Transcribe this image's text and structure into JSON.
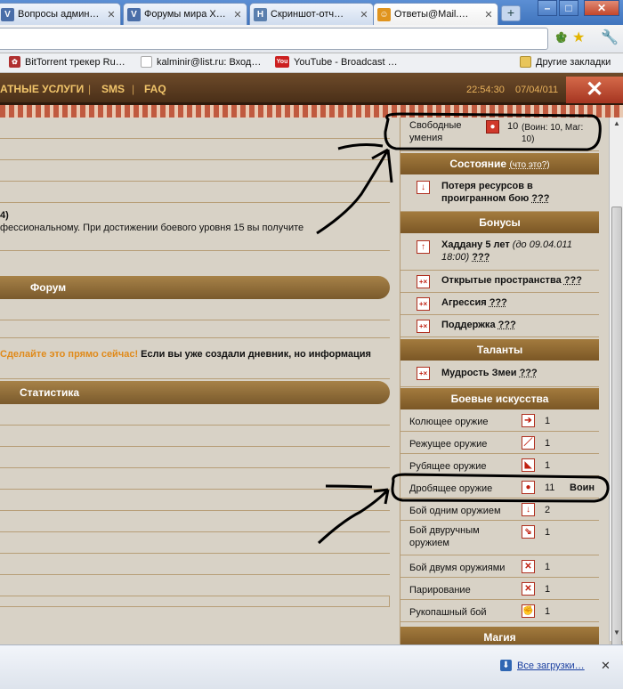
{
  "browser": {
    "tabs": [
      {
        "title": "Вопросы админ…",
        "favicon": "V",
        "color": "#4a6ea8"
      },
      {
        "title": "Форумы мира Х…",
        "favicon": "V",
        "color": "#4a6ea8"
      },
      {
        "title": "Скриншот-отч…",
        "favicon": "H",
        "color": "#5a7fae"
      },
      {
        "title": "Ответы@Mail.…",
        "favicon": "☺",
        "color": "#e0941e"
      }
    ],
    "new_tab": "+",
    "window_buttons": {
      "minimize": "–",
      "maximize": "□",
      "close": "✕"
    },
    "bookmarks": [
      {
        "label": "BitTorrent трекер Ru…",
        "color": "#b03030"
      },
      {
        "label": "kalminir@list.ru: Вход…",
        "color": "#3a5ea0"
      },
      {
        "label": "YouTube - Broadcast …",
        "color": "#cc2020",
        "icon_text": "You"
      }
    ],
    "other_bookmarks": "Другие закладки",
    "downloads_link": "Все загрузки…",
    "downloads_close": "✕"
  },
  "site_nav": {
    "items": [
      "АТНЫЕ  УСЛУГИ",
      "SMS",
      "FAQ"
    ],
    "separator": "|",
    "time": "22:54:30",
    "date": "07/04/011",
    "close": "✕"
  },
  "main": {
    "bold_fragment": "4)",
    "text_line": "фессиональному. При достижении боевого уровня 15 вы получите",
    "forum_header": "Форум",
    "promo_orange": "Сделайте это прямо сейчас!",
    "promo_black": " Если вы уже создали дневник, но информация",
    "stats_header": "Статистика"
  },
  "sidebar": {
    "free_skills": {
      "label": "Свободные умения",
      "value": "10",
      "detail": "(Воин: 10, Маг: 10)"
    },
    "state_header": "Состояние",
    "state_what": "(что это?)",
    "state_items": [
      {
        "name": "Потеря ресурсов в проигранном бою",
        "q": "???",
        "icon": "↓"
      }
    ],
    "bonus_header": "Бонусы",
    "bonus_items": [
      {
        "name": "Хаддану 5 лет",
        "note": "(до 09.04.011 18:00)",
        "q": "???",
        "icon": "↑"
      },
      {
        "name": "Открытые пространства",
        "q": "???",
        "icon": "+×"
      },
      {
        "name": "Агрессия",
        "q": "???",
        "icon": "+×"
      },
      {
        "name": "Поддержка",
        "q": "???",
        "icon": "+×"
      }
    ],
    "talents_header": "Таланты",
    "talent_items": [
      {
        "name": "Мудрость Змеи",
        "q": "???",
        "icon": "+×"
      }
    ],
    "arts_header": "Боевые искусства",
    "arts_items": [
      {
        "name": "Колющее оружие",
        "value": "1",
        "extra": "",
        "icon": "➔"
      },
      {
        "name": "Режущее оружие",
        "value": "1",
        "extra": "",
        "icon": "／"
      },
      {
        "name": "Рубящее оружие",
        "value": "1",
        "extra": "",
        "icon": "◣"
      },
      {
        "name": "Дробящее оружие",
        "value": "11",
        "extra": "Воин",
        "icon": "●"
      },
      {
        "name": "Бой одним оружием",
        "value": "2",
        "extra": "",
        "icon": "↓"
      },
      {
        "name": "Бой двуручным оружием",
        "value": "1",
        "extra": "",
        "icon": "⇘"
      },
      {
        "name": "Бой двумя оружиями",
        "value": "1",
        "extra": "",
        "icon": "✕"
      },
      {
        "name": "Парирование",
        "value": "1",
        "extra": "",
        "icon": "✕"
      },
      {
        "name": "Рукопашный бой",
        "value": "1",
        "extra": "",
        "icon": "✊"
      }
    ],
    "magic_header": "Магия"
  }
}
